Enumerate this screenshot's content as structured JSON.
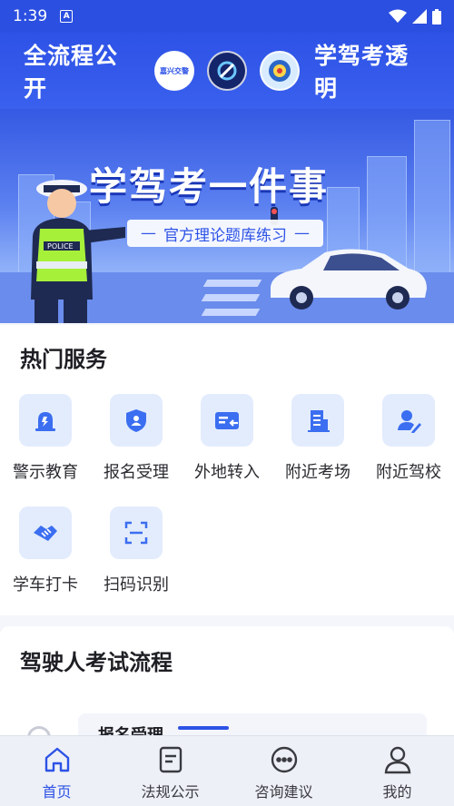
{
  "status_bar": {
    "time": "1:39",
    "badge": "A"
  },
  "header": {
    "left_text": "全流程公开",
    "right_text": "学驾考透明",
    "logo1_text": "嘉兴交警"
  },
  "banner": {
    "title": "学驾考一件事",
    "subtitle": "官方理论题库练习",
    "police_badge": "POLICE"
  },
  "services": {
    "title": "热门服务",
    "items": [
      {
        "label": "警示教育",
        "icon": "alarm-light-icon"
      },
      {
        "label": "报名受理",
        "icon": "shield-user-icon"
      },
      {
        "label": "外地转入",
        "icon": "card-transfer-icon"
      },
      {
        "label": "附近考场",
        "icon": "building-icon"
      },
      {
        "label": "附近驾校",
        "icon": "user-edit-icon"
      },
      {
        "label": "学车打卡",
        "icon": "handshake-icon"
      },
      {
        "label": "扫码识别",
        "icon": "scan-icon"
      }
    ]
  },
  "process": {
    "title": "驾驶人考试流程",
    "first_step": "报名受理"
  },
  "tabbar": {
    "items": [
      {
        "label": "首页",
        "icon": "home-icon",
        "active": true
      },
      {
        "label": "法规公示",
        "icon": "document-icon",
        "active": false
      },
      {
        "label": "咨询建议",
        "icon": "chat-icon",
        "active": false
      },
      {
        "label": "我的",
        "icon": "user-icon",
        "active": false
      }
    ]
  },
  "colors": {
    "primary": "#2d52e6",
    "icon_bg": "#e3ecfd",
    "icon_fg": "#3b6ef0"
  }
}
